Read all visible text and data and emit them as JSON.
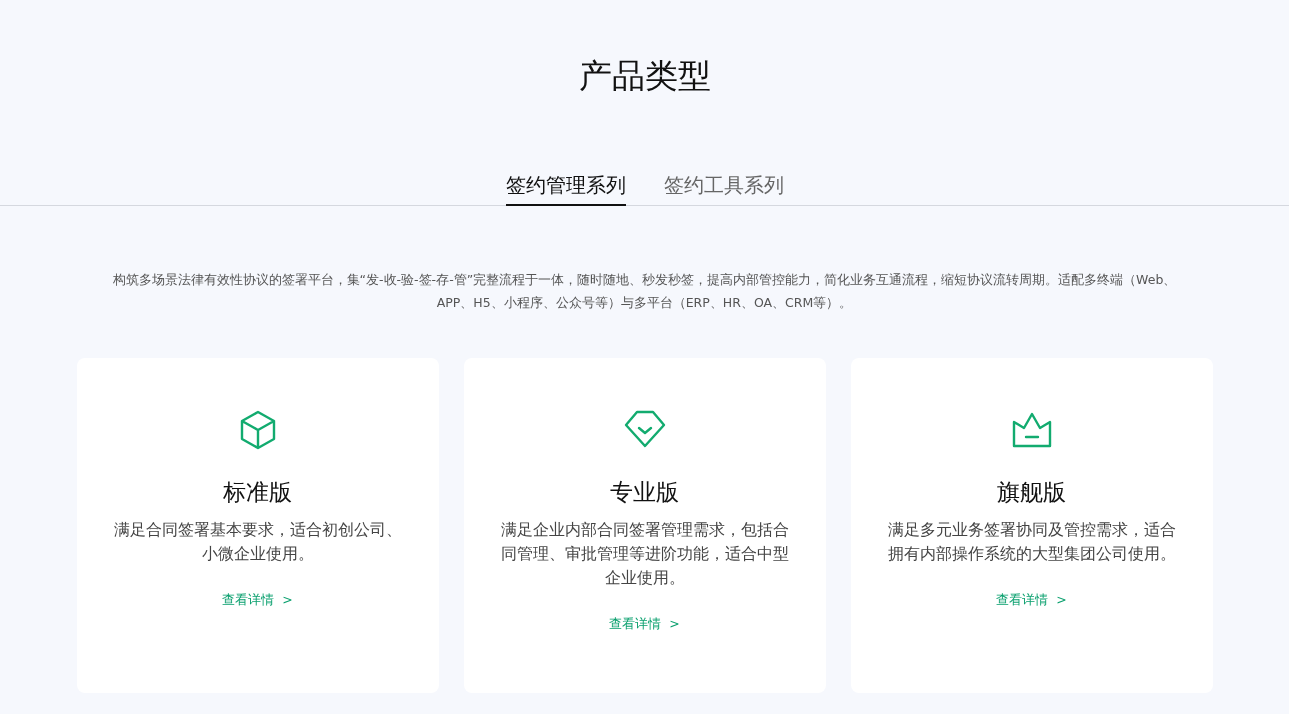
{
  "title": "产品类型",
  "tabs": [
    {
      "label": "签约管理系列",
      "selected": true
    },
    {
      "label": "签约工具系列",
      "selected": false
    }
  ],
  "description": "构筑多场景法律有效性协议的签署平台，集“发-收-验-签-存-管”完整流程于一体，随时随地、秒发秒签，提高内部管控能力，简化业务互通流程，缩短协议流转周期。适配多终端（Web、APP、H5、小程序、公众号等）与多平台（ERP、HR、OA、CRM等）。",
  "cards": [
    {
      "kind": "cube",
      "name": "标准版",
      "text": "满足合同签署基本要求，适合初创公司、小微企业使用。",
      "link": "查看详情",
      "arrow": ">"
    },
    {
      "kind": "diamond",
      "name": "专业版",
      "text": "满足企业内部合同签署管理需求，包括合同管理、审批管理等进阶功能，适合中型企业使用。",
      "link": "查看详情",
      "arrow": ">"
    },
    {
      "kind": "crown",
      "name": "旗舰版",
      "text": "满足多元业务签署协同及管控需求，适合拥有内部操作系统的大型集团公司使用。",
      "link": "查看详情",
      "arrow": ">"
    }
  ]
}
